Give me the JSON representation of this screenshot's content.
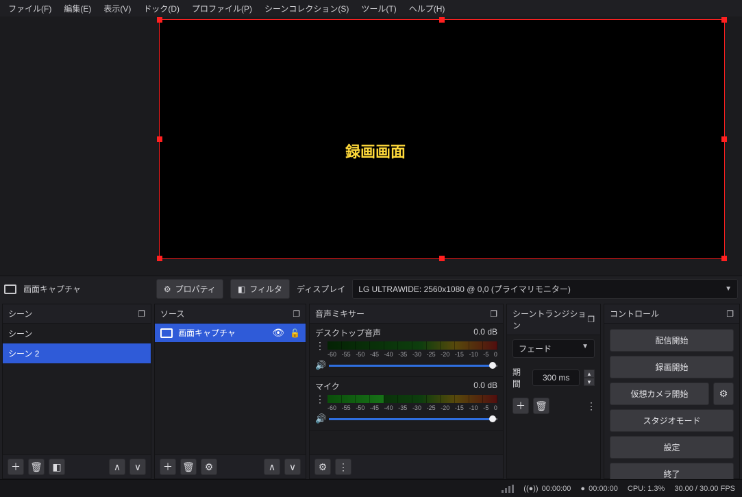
{
  "menu": {
    "file": "ファイル(F)",
    "edit": "編集(E)",
    "view": "表示(V)",
    "dock": "ドック(D)",
    "profile": "プロファイル(P)",
    "scenecol": "シーンコレクション(S)",
    "tools": "ツール(T)",
    "help": "ヘルプ(H)"
  },
  "preview": {
    "label": "録画画面"
  },
  "source_toolbar": {
    "current_source": "画面キャプチャ",
    "properties": "プロパティ",
    "filters": "フィルタ",
    "display_label": "ディスプレイ",
    "display_value": "LG ULTRAWIDE: 2560x1080 @ 0,0 (プライマリモニター)"
  },
  "docks": {
    "scenes": {
      "title": "シーン",
      "items": [
        "シーン",
        "シーン 2"
      ],
      "selected": 1
    },
    "sources": {
      "title": "ソース",
      "items": [
        {
          "name": "画面キャプチャ",
          "visible": true,
          "locked": false
        }
      ],
      "selected": 0
    },
    "mixer": {
      "title": "音声ミキサー",
      "scale_ticks": [
        "-60",
        "-55",
        "-50",
        "-45",
        "-40",
        "-35",
        "-30",
        "-25",
        "-20",
        "-15",
        "-10",
        "-5",
        "0"
      ],
      "channels": [
        {
          "name": "デスクトップ音声",
          "db": "0.0 dB",
          "level_pct": 0,
          "vol_pct": 100
        },
        {
          "name": "マイク",
          "db": "0.0 dB",
          "level_pct": 33,
          "vol_pct": 100
        }
      ]
    },
    "transitions": {
      "title": "シーントランジション",
      "value": "フェード",
      "duration_label": "期間",
      "duration_value": "300 ms"
    },
    "controls": {
      "title": "コントロール",
      "start_stream": "配信開始",
      "start_record": "録画開始",
      "virtual_cam": "仮想カメラ開始",
      "studio": "スタジオモード",
      "settings": "設定",
      "exit": "終了"
    }
  },
  "status": {
    "live_time": "00:00:00",
    "rec_time": "00:00:00",
    "cpu": "CPU: 1.3%",
    "fps": "30.00 / 30.00 FPS"
  }
}
